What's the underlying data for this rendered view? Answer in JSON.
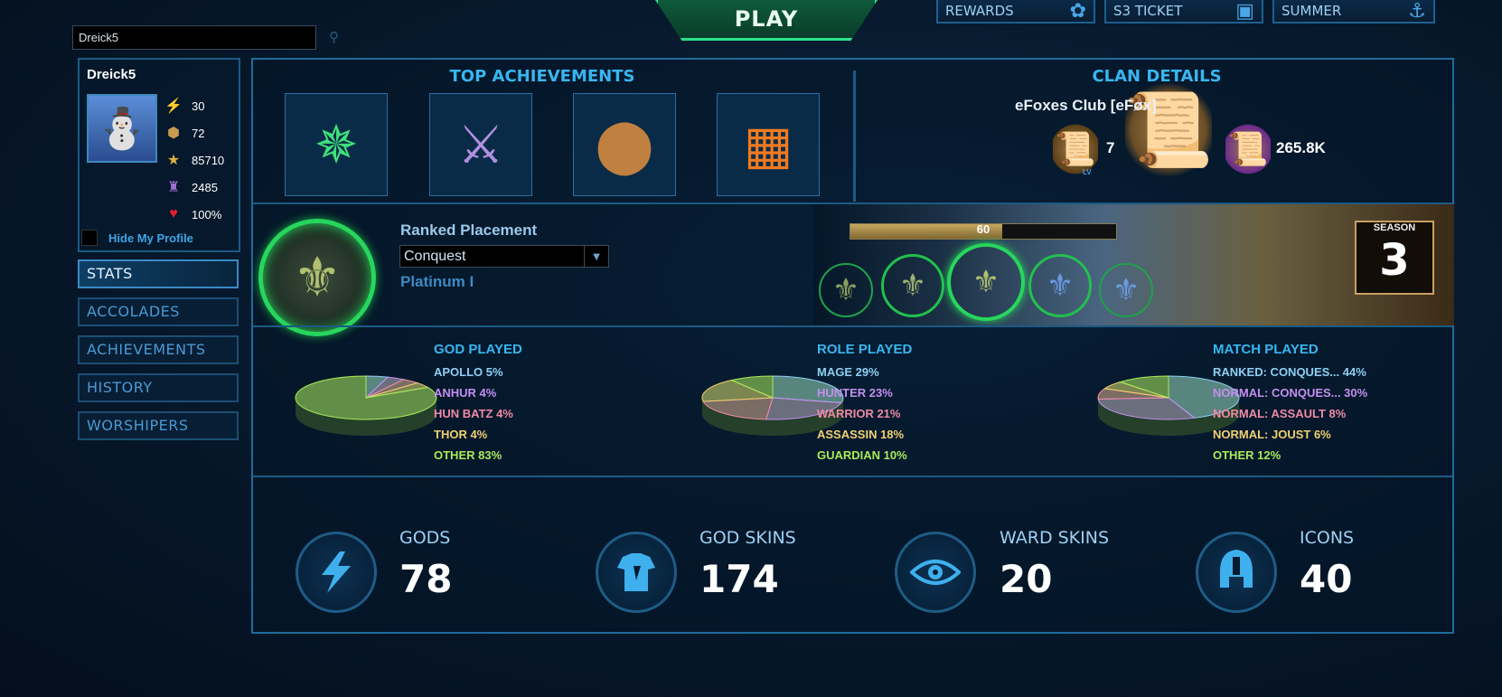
{
  "top_bar": {
    "play_label": "PLAY",
    "tabs": [
      {
        "label": "REWARDS",
        "icon": "bow-icon"
      },
      {
        "label": "S3 TICKET",
        "icon": "ticket-icon"
      },
      {
        "label": "SUMMER",
        "icon": "anchor-icon"
      }
    ]
  },
  "search": {
    "value": "Dreick5"
  },
  "profile": {
    "name": "Dreick5",
    "avatar_icon": "snowman-icon",
    "level": "30",
    "mastery": "72",
    "points": "85710",
    "worshipers": "2485",
    "health": "100%",
    "hide_label": "Hide My Profile"
  },
  "nav": [
    "STATS",
    "ACCOLADES",
    "ACHIEVEMENTS",
    "HISTORY",
    "WORSHIPERS"
  ],
  "achievements": {
    "title": "TOP ACHIEVEMENTS"
  },
  "clan": {
    "title": "CLAN DETAILS",
    "name": "eFoxes Club [eFøx]",
    "level": "7",
    "level_tag": "LV",
    "worshipers": "265.8K"
  },
  "ranked": {
    "title": "Ranked Placement",
    "queue": "Conquest",
    "tier": "Platinum I",
    "progress_label": "60",
    "progress_value": 0.57,
    "season_label": "SEASON",
    "season_number": "3"
  },
  "colors": {
    "accent": "#38b6f0",
    "green": "#27d65c",
    "purple": "#c48ff0",
    "pink": "#f08aa6",
    "yellow": "#f0d070",
    "lime": "#a8ea5a"
  },
  "chart_data": [
    {
      "type": "pie",
      "title": "GOD PLAYED",
      "categories": [
        "APOLLO",
        "ANHUR",
        "HUN BATZ",
        "THOR",
        "OTHER"
      ],
      "values": [
        5,
        4,
        4,
        4,
        83
      ],
      "labels": [
        "APOLLO 5%",
        "ANHUR 4%",
        "HUN BATZ 4%",
        "THOR 4%",
        "OTHER 83%"
      ],
      "colors": [
        "#8ecff5",
        "#c48ff0",
        "#f08aa6",
        "#f0d070",
        "#a8ea5a"
      ]
    },
    {
      "type": "pie",
      "title": "ROLE PLAYED",
      "categories": [
        "MAGE",
        "HUNTER",
        "WARRIOR",
        "ASSASSIN",
        "GUARDIAN"
      ],
      "values": [
        29,
        23,
        21,
        18,
        10
      ],
      "labels": [
        "MAGE 29%",
        "HUNTER 23%",
        "WARRIOR 21%",
        "ASSASSIN 18%",
        "GUARDIAN 10%"
      ],
      "colors": [
        "#8ecff5",
        "#c48ff0",
        "#f08aa6",
        "#f0d070",
        "#a8ea5a"
      ]
    },
    {
      "type": "pie",
      "title": "MATCH PLAYED",
      "categories": [
        "RANKED: CONQUES...",
        "NORMAL: CONQUES...",
        "NORMAL: ASSAULT",
        "NORMAL: JOUST",
        "OTHER"
      ],
      "values": [
        44,
        30,
        8,
        6,
        12
      ],
      "labels": [
        "RANKED: CONQUES... 44%",
        "NORMAL: CONQUES... 30%",
        "NORMAL: ASSAULT 8%",
        "NORMAL: JOUST 6%",
        "OTHER 12%"
      ],
      "colors": [
        "#8ecff5",
        "#c48ff0",
        "#f08aa6",
        "#f0d070",
        "#a8ea5a"
      ]
    }
  ],
  "counters": [
    {
      "label": "GODS",
      "value": "78",
      "icon": "lightning-icon"
    },
    {
      "label": "GOD SKINS",
      "value": "174",
      "icon": "armor-icon"
    },
    {
      "label": "WARD SKINS",
      "value": "20",
      "icon": "eye-icon"
    },
    {
      "label": "ICONS",
      "value": "40",
      "icon": "helmet-icon"
    }
  ]
}
